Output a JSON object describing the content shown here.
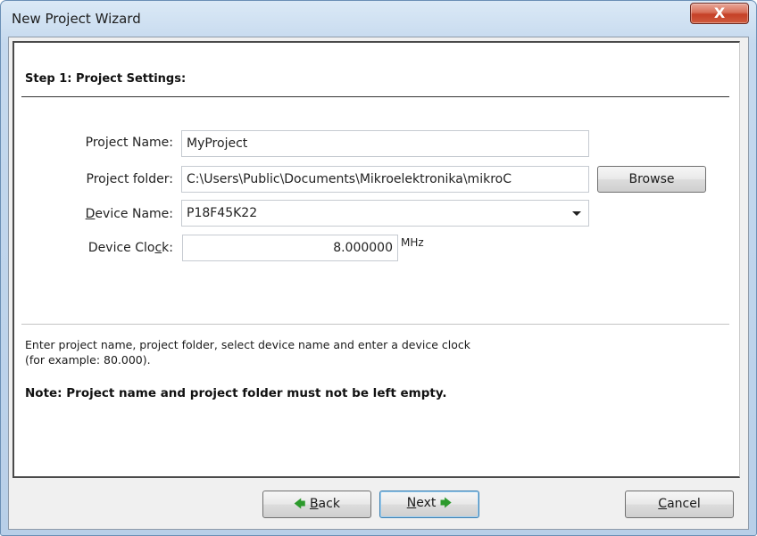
{
  "window": {
    "title": "New Project Wizard",
    "close_glyph": "X"
  },
  "step": {
    "title": "Step 1: Project Settings:"
  },
  "fields": {
    "project_name": {
      "label": "Project Name:",
      "value": "MyProject"
    },
    "project_folder": {
      "label": "Project folder:",
      "value": "C:\\Users\\Public\\Documents\\Mikroelektronika\\mikroC",
      "browse_label": "Browse"
    },
    "device_name": {
      "label_underline": "D",
      "label_rest": "evice Name:",
      "value": "P18F45K22"
    },
    "device_clock": {
      "label_pre": "Device Clo",
      "label_underline": "c",
      "label_post": "k:",
      "value": "8.000000",
      "unit": "MHz"
    }
  },
  "hint": {
    "line1": "Enter project name, project folder, select device name and enter a device clock",
    "line2": "(for example: 80.000)."
  },
  "note": "Note: Project name and project folder must not be left empty.",
  "buttons": {
    "back": {
      "arrow": "🡄",
      "underline": "B",
      "rest": "ack"
    },
    "next": {
      "underline": "N",
      "rest": "ext",
      "arrow": "🡆"
    },
    "cancel": {
      "underline": "C",
      "rest": "ancel"
    }
  },
  "icons": {
    "dropdown": "chevron-down-icon",
    "back_arrow": "arrow-left-icon",
    "next_arrow": "arrow-right-icon"
  },
  "colors": {
    "title_bar": "#c5d9ee",
    "close_button": "#c54027",
    "arrow": "#2c9a2c"
  }
}
